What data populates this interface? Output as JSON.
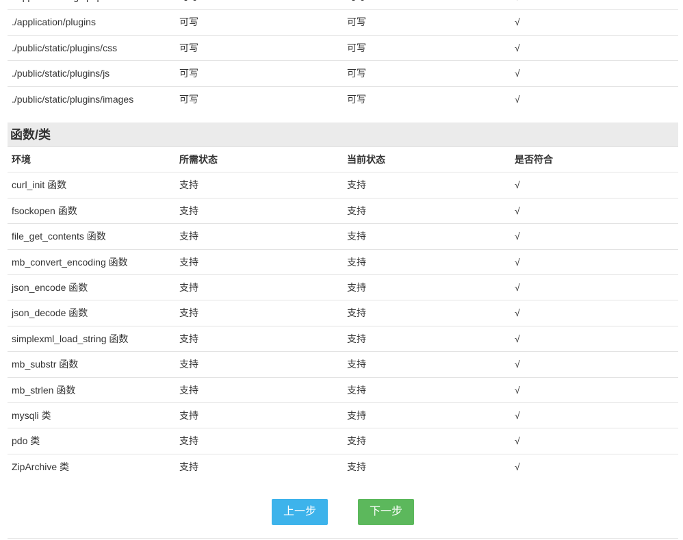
{
  "directories": {
    "rows": [
      {
        "path": "./application/tags.php",
        "required": "可写",
        "current": "可写",
        "ok": "√"
      },
      {
        "path": "./application/plugins",
        "required": "可写",
        "current": "可写",
        "ok": "√"
      },
      {
        "path": "./public/static/plugins/css",
        "required": "可写",
        "current": "可写",
        "ok": "√"
      },
      {
        "path": "./public/static/plugins/js",
        "required": "可写",
        "current": "可写",
        "ok": "√"
      },
      {
        "path": "./public/static/plugins/images",
        "required": "可写",
        "current": "可写",
        "ok": "√"
      }
    ]
  },
  "functions": {
    "title": "函数/类",
    "headers": {
      "env": "环境",
      "required": "所需状态",
      "current": "当前状态",
      "ok": "是否符合"
    },
    "rows": [
      {
        "name": "curl_init 函数",
        "required": "支持",
        "current": "支持",
        "ok": "√"
      },
      {
        "name": "fsockopen 函数",
        "required": "支持",
        "current": "支持",
        "ok": "√"
      },
      {
        "name": "file_get_contents 函数",
        "required": "支持",
        "current": "支持",
        "ok": "√"
      },
      {
        "name": "mb_convert_encoding 函数",
        "required": "支持",
        "current": "支持",
        "ok": "√"
      },
      {
        "name": "json_encode 函数",
        "required": "支持",
        "current": "支持",
        "ok": "√"
      },
      {
        "name": "json_decode 函数",
        "required": "支持",
        "current": "支持",
        "ok": "√"
      },
      {
        "name": "simplexml_load_string 函数",
        "required": "支持",
        "current": "支持",
        "ok": "√"
      },
      {
        "name": "mb_substr 函数",
        "required": "支持",
        "current": "支持",
        "ok": "√"
      },
      {
        "name": "mb_strlen 函数",
        "required": "支持",
        "current": "支持",
        "ok": "√"
      },
      {
        "name": "mysqli 类",
        "required": "支持",
        "current": "支持",
        "ok": "√"
      },
      {
        "name": "pdo 类",
        "required": "支持",
        "current": "支持",
        "ok": "√"
      },
      {
        "name": "ZipArchive 类",
        "required": "支持",
        "current": "支持",
        "ok": "√"
      }
    ]
  },
  "buttons": {
    "prev_label": "上一步",
    "next_label": "下一步",
    "prev_color": "#3db3eb",
    "next_color": "#5cb85c"
  }
}
